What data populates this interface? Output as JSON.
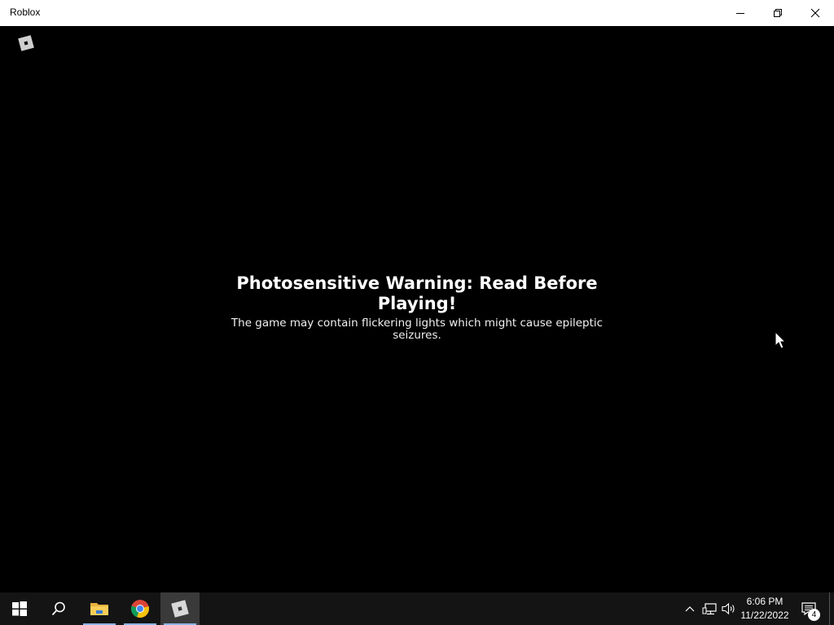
{
  "window": {
    "title": "Roblox",
    "controls": [
      "minimize",
      "restore",
      "close"
    ]
  },
  "warning": {
    "headline": "Photosensitive Warning: Read Before Playing!",
    "body": "The game may contain flickering lights which might cause epileptic seizures."
  },
  "taskbar": {
    "items": [
      {
        "name": "start",
        "icon": "windows-icon"
      },
      {
        "name": "search",
        "icon": "search-icon"
      },
      {
        "name": "file-explorer",
        "icon": "folder-icon"
      },
      {
        "name": "chrome",
        "icon": "chrome-icon"
      },
      {
        "name": "roblox",
        "icon": "roblox-icon",
        "active": true
      }
    ],
    "clock": {
      "time": "6:06 PM",
      "date": "11/22/2022"
    },
    "notification_count": "4"
  },
  "colors": {
    "background": "#000000",
    "titlebar": "#ffffff",
    "taskbar": "#141414",
    "active_underline": "#8cb4e6"
  }
}
